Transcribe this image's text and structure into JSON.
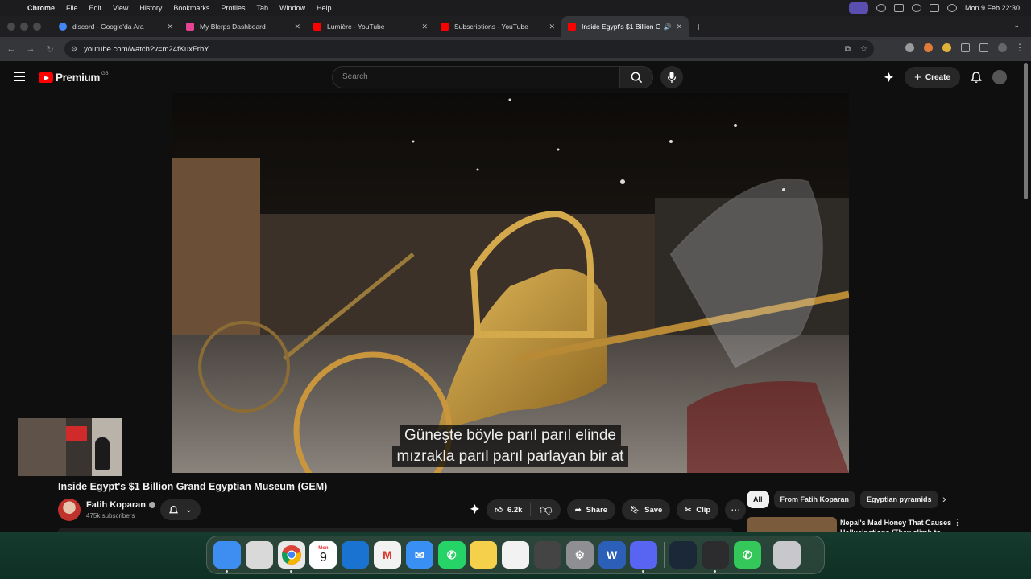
{
  "menubar": {
    "app": "Chrome",
    "items": [
      "File",
      "Edit",
      "View",
      "History",
      "Bookmarks",
      "Profiles",
      "Tab",
      "Window",
      "Help"
    ],
    "clock": "Mon 9 Feb  22:30"
  },
  "tabs": [
    {
      "title": "discord - Google'da Ara",
      "favicon_color": "#4285f4"
    },
    {
      "title": "My Blerps Dashboard",
      "favicon_color": "#e84393"
    },
    {
      "title": "Lumière - YouTube",
      "favicon_color": "#ff0000"
    },
    {
      "title": "Subscriptions - YouTube",
      "favicon_color": "#ff0000"
    },
    {
      "title": "Inside Egypt's $1 Billion G",
      "favicon_color": "#ff0000",
      "active": true,
      "audio": true
    }
  ],
  "address": {
    "url": "youtube.com/watch?v=m24fKuxFrhY"
  },
  "youtube": {
    "logo_text": "Premium",
    "country_code": "GB",
    "search_placeholder": "Search",
    "create_label": "Create"
  },
  "video": {
    "subtitle_line1": "Güneşte böyle parıl parıl elinde",
    "subtitle_line2": "mızrakla parıl parıl parlayan bir at",
    "title": "Inside Egypt's $1 Billion Grand Egyptian Museum (GEM)",
    "channel_name": "Fatih Koparan",
    "subscribers": "475k subscribers",
    "likes": "6.2k",
    "share_label": "Share",
    "save_label": "Save",
    "clip_label": "Clip"
  },
  "sidebar": {
    "chips": [
      "All",
      "From Fatih Koparan",
      "Egyptian pyramids"
    ],
    "rec_title": "Nepal's Mad Honey That Causes Hallucinations (They climb to"
  },
  "dock": {
    "calendar_month": "Mon",
    "calendar_day": "9",
    "apps": [
      {
        "name": "finder",
        "color": "#3d8ef0"
      },
      {
        "name": "launchpad",
        "color": "#d9d9d9"
      },
      {
        "name": "chrome",
        "color": "#e8e8e8"
      },
      {
        "name": "calendar",
        "color": "#ffffff"
      },
      {
        "name": "outlook",
        "color": "#1a73d1"
      },
      {
        "name": "gmail",
        "color": "#f2f2f2"
      },
      {
        "name": "mail",
        "color": "#3a8ff5"
      },
      {
        "name": "whatsapp",
        "color": "#25d366"
      },
      {
        "name": "notes",
        "color": "#f5d04a"
      },
      {
        "name": "reminders",
        "color": "#f2f2f2"
      },
      {
        "name": "keychain",
        "color": "#444"
      },
      {
        "name": "settings",
        "color": "#8e8e93"
      },
      {
        "name": "word",
        "color": "#2b5fb8"
      },
      {
        "name": "discord",
        "color": "#5865f2"
      },
      {
        "name": "steam",
        "color": "#1b2838"
      },
      {
        "name": "screen-time",
        "color": "#2c2c2e"
      },
      {
        "name": "phone",
        "color": "#34c759"
      },
      {
        "name": "trash",
        "color": "#c7c7cc"
      }
    ]
  }
}
